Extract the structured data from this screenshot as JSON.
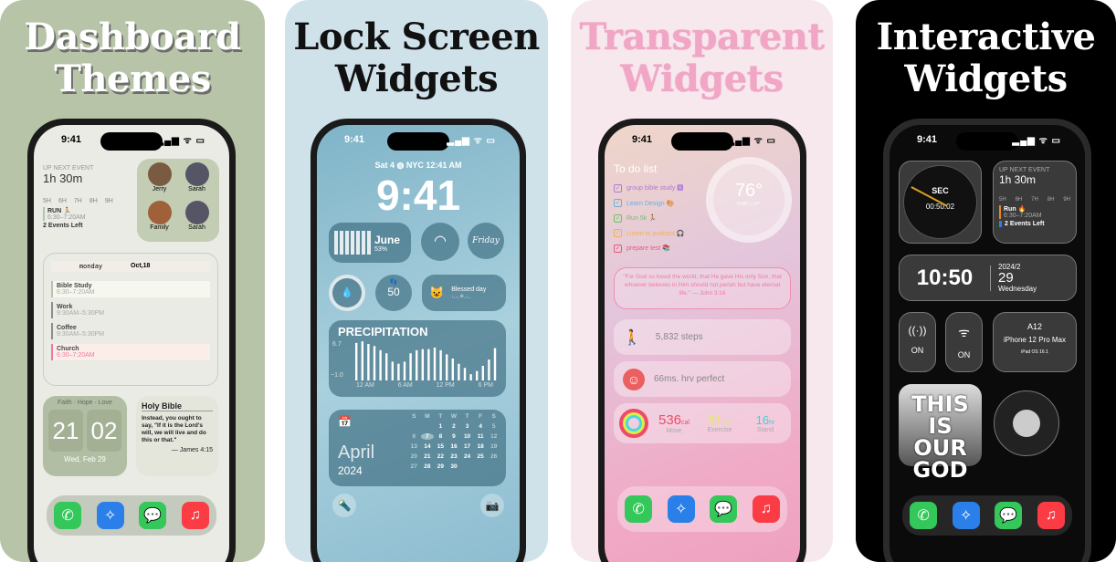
{
  "panels": [
    {
      "title_line1": "Dashboard",
      "title_line2": "Themes",
      "bg": "#b7c4a8"
    },
    {
      "title_line1": "Lock Screen",
      "title_line2": "Widgets",
      "bg": "#cfe2ea"
    },
    {
      "title_line1": "Transparent",
      "title_line2": "Widgets",
      "bg": "#f7e8ee"
    },
    {
      "title_line1": "Interactive",
      "title_line2": "Widgets",
      "bg": "#000000"
    }
  ],
  "status_time": "9:41",
  "status_icons": "▂▄▆ ᯤ ▭",
  "dashboard": {
    "up_next": {
      "label": "UP NEXT EVENT",
      "time": "1h 30m",
      "hours": [
        "5H",
        "6H",
        "7H",
        "8H",
        "9H"
      ],
      "event": "RUN 🏃",
      "event_time": "6:30–7:20AM",
      "events_left": "2 Events Left"
    },
    "contacts": [
      {
        "name": "Jerry"
      },
      {
        "name": "Sarah"
      },
      {
        "name": "Family"
      },
      {
        "name": "Sarah"
      }
    ],
    "planner": {
      "day": "monday",
      "date": "Oct,18",
      "events": [
        {
          "title": "Bible Study",
          "time": "6:30–7:20AM",
          "color": "#b7c4a8"
        },
        {
          "title": "Work",
          "time": "9:30AM–5:30PM",
          "color": "#8d8d8d"
        },
        {
          "title": "Coffee",
          "time": "9:30AM–5:30PM",
          "color": "#8d8d8d"
        },
        {
          "title": "Church",
          "time": "6:30–7:20AM",
          "color": "#f07aa0"
        }
      ]
    },
    "flip_clock": {
      "caption": "Faith · Hope · Love",
      "hour": "21",
      "minute": "02",
      "date": "Wed, Feb 29"
    },
    "bible": {
      "title": "Holy Bible",
      "verse": "Instead, you ought to say, \"If it is the Lord's will, we will live and do this or that.\"",
      "ref": "— James 4:15"
    }
  },
  "lockscreen": {
    "date_line": "Sat 4 ◍ NYC 12:41 AM",
    "clock": "9:41",
    "month_widget": {
      "month": "June",
      "percent": "53%"
    },
    "friday": "Friday",
    "steps": "50",
    "blessed": {
      "title": "Blessed day",
      "sub": "·.·.✧.·."
    },
    "precipitation": {
      "title": "PRECIPITATION",
      "y_max": "6.7",
      "y_min": "−1.0",
      "x_labels": [
        "12 AM",
        "6 AM",
        "12 PM",
        "6 PM"
      ],
      "values": [
        6.2,
        6.5,
        6.0,
        5.6,
        4.8,
        4.2,
        2.6,
        2.2,
        2.6,
        4.2,
        4.8,
        5.0,
        5.0,
        5.3,
        4.8,
        4.0,
        3.2,
        2.2,
        1.4,
        0.2,
        0.8,
        1.8,
        3.0,
        5.2
      ]
    },
    "calendar": {
      "month": "April",
      "year": "2024",
      "weekdays": [
        "S",
        "M",
        "T",
        "W",
        "T",
        "F",
        "S"
      ],
      "days": [
        "",
        "",
        "1",
        "2",
        "3",
        "4",
        "5",
        "6",
        "7",
        "8",
        "9",
        "10",
        "11",
        "12",
        "13",
        "14",
        "15",
        "16",
        "17",
        "18",
        "19",
        "20",
        "21",
        "22",
        "23",
        "24",
        "25",
        "26",
        "27",
        "28",
        "29",
        "30"
      ],
      "today": "7"
    }
  },
  "transparent": {
    "todo_title": "To do list",
    "todos": [
      {
        "text": "group bible study 🅱",
        "color": "#b07ad8"
      },
      {
        "text": "Learn Design 🎨",
        "color": "#6ab0e0"
      },
      {
        "text": "Run 5k 🏃",
        "color": "#6cc46c"
      },
      {
        "text": "Listen to podcast 🎧",
        "color": "#f0b060"
      },
      {
        "text": "prepare test 📚",
        "color": "#e85a80"
      }
    ],
    "weather": {
      "temp": "76°",
      "range": "H:86° L:57°"
    },
    "quote": "\"For God so loved the world, that He gave His only Son, that whoever believes in Him should not perish but have eternal life.\" — John 3:16",
    "steps": "5,832 steps",
    "hrv": "66ms. hrv perfect",
    "activity": {
      "move": "536",
      "move_unit": "cal",
      "move_label": "Move",
      "exercise": "31",
      "exercise_unit": "min",
      "exercise_label": "Exercise",
      "stand": "16",
      "stand_unit": "hr",
      "stand_label": "Stand"
    }
  },
  "interactive": {
    "stopwatch": {
      "label": "SEC",
      "time": "00:50.02"
    },
    "up_next": {
      "label": "UP NEXT EVENT",
      "time": "1h 30m",
      "hours": [
        "5H",
        "6H",
        "7H",
        "8H",
        "9H"
      ],
      "event": "Run 🔥",
      "event_time": "6:30–7:20AM",
      "events_left": "2 Events Left"
    },
    "clock": {
      "time": "10:50",
      "ym": "2024/2",
      "day": "29",
      "weekday": "Wednesday"
    },
    "cellular": "ON",
    "wifi": "ON",
    "device": {
      "chip": "A12",
      "model": "iPhone 12 Pro Max",
      "os": "iPad OS 16.1"
    },
    "album": "THIS IS OUR GOD"
  }
}
